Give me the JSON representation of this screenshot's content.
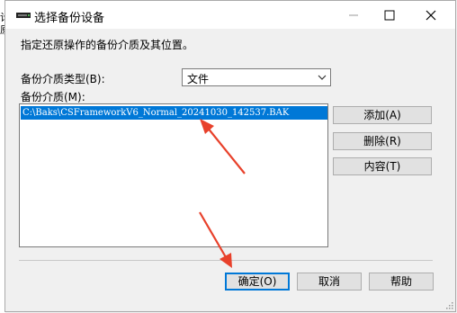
{
  "background": {
    "partial_chars": [
      "计",
      "原"
    ]
  },
  "dialog": {
    "title": "选择备份设备",
    "description": "指定还原操作的备份介质及其位置。",
    "media_type_label": "备份介质类型(B):",
    "media_type_value": "文件",
    "media_label": "备份介质(M):",
    "media_items": [
      "C:\\Baks\\CSFrameworkV6_Normal_20241030_142537.BAK"
    ],
    "buttons": {
      "add": "添加(A)",
      "remove": "删除(R)",
      "contents": "内容(T)",
      "ok": "确定(O)",
      "cancel": "取消",
      "help": "帮助"
    }
  },
  "colors": {
    "selection": "#0078d7",
    "annotation_arrow": "#e8412b"
  },
  "icons": [
    "drive-icon",
    "minimize-icon",
    "maximize-icon",
    "close-icon",
    "chevron-down-icon",
    "resize-grip-icon"
  ]
}
